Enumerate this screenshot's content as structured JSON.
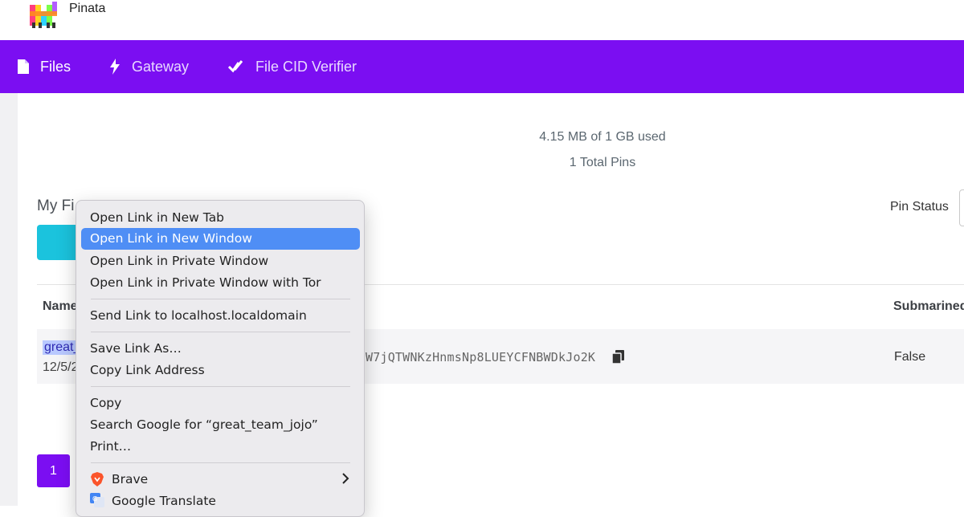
{
  "app": {
    "brand": "Pinata"
  },
  "nav": {
    "items": [
      {
        "label": "Files",
        "icon": "file-icon",
        "active": true
      },
      {
        "label": "Gateway",
        "icon": "bolt-icon",
        "active": false
      },
      {
        "label": "File CID Verifier",
        "icon": "double-check-icon",
        "active": false
      }
    ],
    "accent": "#7b0ef2"
  },
  "usage": {
    "storage": "4.15 MB of 1 GB used",
    "pins": "1 Total Pins"
  },
  "files": {
    "title_visible": "My Fi",
    "pin_status_label": "Pin Status",
    "columns": {
      "name": "Name",
      "submarined": "Submarined"
    },
    "row": {
      "name_visible": "great_",
      "date_visible": "12/5/2",
      "cid_visible": "W7jQTWNKzHnmsNp8LUEYCFNBWDkJo2K",
      "submarined": "False"
    },
    "page": "1"
  },
  "context_menu": {
    "items": [
      "Open Link in New Tab",
      "Open Link in New Window",
      "Open Link in Private Window",
      "Open Link in Private Window with Tor",
      "Send Link to localhost.localdomain",
      "Save Link As…",
      "Copy Link Address",
      "Copy",
      "Search Google for “great_team_jojo”",
      "Print…",
      "Brave",
      "Google Translate"
    ],
    "highlighted": "Open Link in New Window"
  }
}
